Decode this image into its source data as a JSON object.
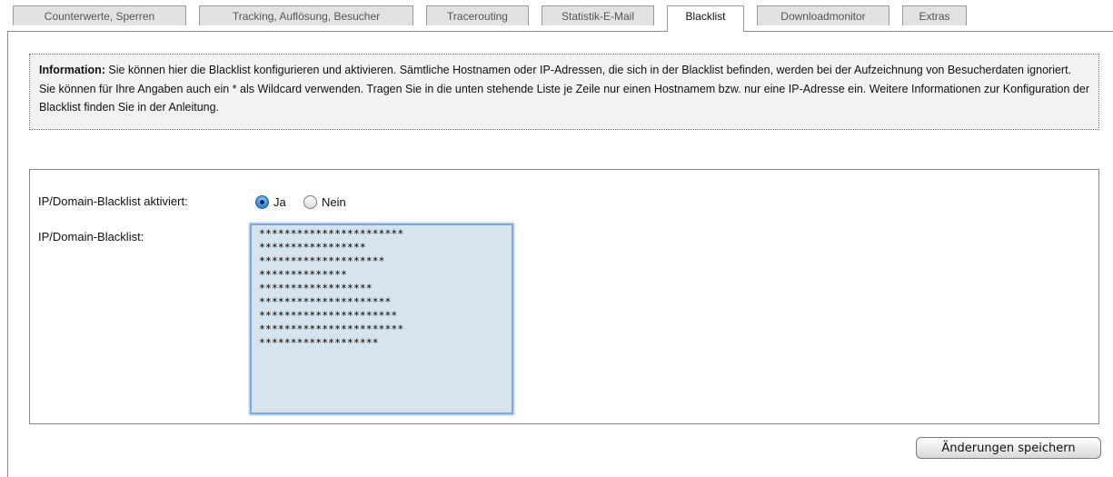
{
  "tabs": [
    {
      "label": "Counterwerte, Sperren",
      "active": false
    },
    {
      "label": "Tracking, Auflösung, Besucher",
      "active": false
    },
    {
      "label": "Tracerouting",
      "active": false
    },
    {
      "label": "Statistik-E-Mail",
      "active": false
    },
    {
      "label": "Blacklist",
      "active": true
    },
    {
      "label": "Downloadmonitor",
      "active": false
    },
    {
      "label": "Extras",
      "active": false
    }
  ],
  "info": {
    "heading": "Information:",
    "text": "Sie können hier die Blacklist konfigurieren und aktivieren. Sämtliche Hostnamen oder IP-Adressen, die sich in der Blacklist befinden, werden bei der Aufzeichnung von Besucherdaten ignoriert. Sie können für Ihre Angaben auch ein * als Wildcard verwenden. Tragen Sie in die unten stehende Liste je Zeile nur einen Hostnamem bzw. nur eine IP-Adresse ein. Weitere Informationen zur Konfiguration der Blacklist finden Sie in der Anleitung."
  },
  "form": {
    "active_label": "IP/Domain-Blacklist aktiviert:",
    "radio_yes": "Ja",
    "radio_no": "Nein",
    "selected": "Ja",
    "list_label": "IP/Domain-Blacklist:",
    "list_value": "***********************\n*****************\n********************\n**************\n******************\n*********************\n**********************\n***********************\n*******************"
  },
  "save_label": "Änderungen speichern"
}
